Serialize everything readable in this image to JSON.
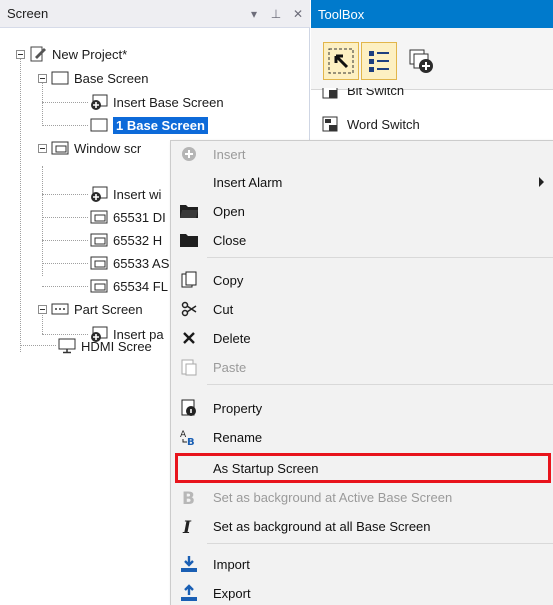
{
  "screen_panel": {
    "title": "Screen",
    "dropdown_glyph": "▾",
    "pin_glyph": "⊥",
    "close_glyph": "✕"
  },
  "tree": {
    "project": "New Project*",
    "base_screen": "Base Screen",
    "insert_base_screen": "Insert Base Screen",
    "base_screen_1": "1 Base Screen",
    "window_screen": "Window scr",
    "insert_window": "Insert wi",
    "win_65531": "65531 DI",
    "win_65532": "65532 H",
    "win_65533": "65533 AS",
    "win_65534": "65534 FL",
    "part_screen": "Part Screen",
    "insert_part": "Insert pa",
    "hdmi_screen": "HDMI Scree"
  },
  "toolbox": {
    "title": "ToolBox",
    "items": {
      "bit_switch": "Bit Switch",
      "word_switch": "Word Switch"
    }
  },
  "context_menu": {
    "insert": "Insert",
    "insert_alarm": "Insert Alarm",
    "open": "Open",
    "close": "Close",
    "copy": "Copy",
    "cut": "Cut",
    "delete": "Delete",
    "paste": "Paste",
    "property": "Property",
    "rename": "Rename",
    "as_startup_screen": "As Startup Screen",
    "set_bg_active": "Set as background at Active Base Screen",
    "set_bg_all": "Set as background at all Base Screen",
    "import": "Import",
    "export": "Export"
  },
  "colors": {
    "accent": "#007acc",
    "selection": "#0d6ad9",
    "highlight_border": "#e8141c"
  }
}
